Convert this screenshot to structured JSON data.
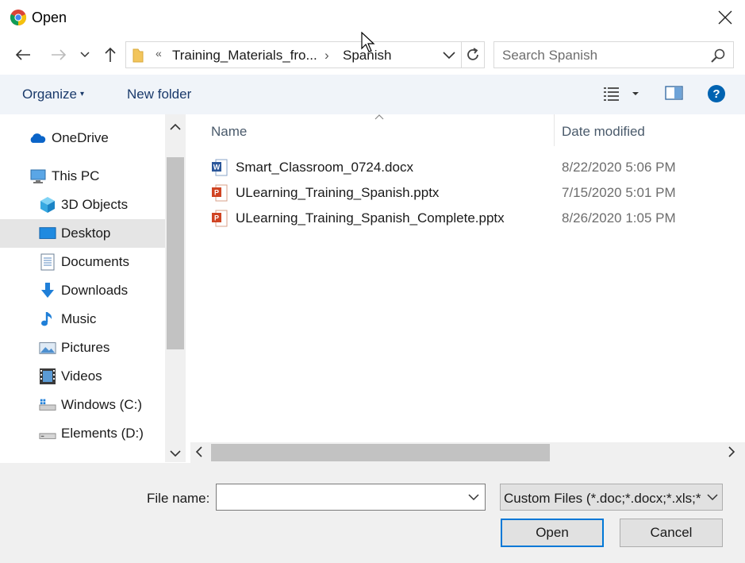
{
  "window": {
    "title": "Open",
    "app_icon": "chrome-icon",
    "close_icon": "close-icon"
  },
  "navigation": {
    "back_icon": "back-arrow-icon",
    "forward_icon": "forward-arrow-icon",
    "recent_icon": "chevron-down-icon",
    "up_icon": "up-arrow-icon",
    "address": {
      "overflow": "«",
      "crumbs": [
        "Training_Materials_fro...",
        "Spanish"
      ],
      "separator": "›"
    },
    "refresh_icon": "refresh-icon",
    "search": {
      "placeholder": "Search Spanish"
    }
  },
  "commandbar": {
    "organize": "Organize",
    "organize_arrow": "▾",
    "new_folder": "New folder",
    "view_icon": "details-view-icon",
    "preview_icon": "preview-pane-icon",
    "help_icon": "help-icon"
  },
  "sidebar": {
    "items": [
      {
        "label": "OneDrive",
        "icon": "onedrive-icon",
        "selected": false
      },
      {
        "label": "This PC",
        "icon": "this-pc-icon",
        "selected": false
      },
      {
        "label": "3D Objects",
        "icon": "3d-objects-icon",
        "selected": false
      },
      {
        "label": "Desktop",
        "icon": "desktop-icon",
        "selected": true
      },
      {
        "label": "Documents",
        "icon": "documents-icon",
        "selected": false
      },
      {
        "label": "Downloads",
        "icon": "downloads-icon",
        "selected": false
      },
      {
        "label": "Music",
        "icon": "music-icon",
        "selected": false
      },
      {
        "label": "Pictures",
        "icon": "pictures-icon",
        "selected": false
      },
      {
        "label": "Videos",
        "icon": "videos-icon",
        "selected": false
      },
      {
        "label": "Windows (C:)",
        "icon": "drive-c-icon",
        "selected": false
      },
      {
        "label": "Elements (D:)",
        "icon": "drive-d-icon",
        "selected": false
      }
    ]
  },
  "filelist": {
    "columns": [
      "Name",
      "Date modified"
    ],
    "files": [
      {
        "name": "Smart_Classroom_0724.docx",
        "date": "8/22/2020 5:06 PM",
        "type": "word"
      },
      {
        "name": "ULearning_Training_Spanish.pptx",
        "date": "7/15/2020 5:01 PM",
        "type": "powerpoint"
      },
      {
        "name": "ULearning_Training_Spanish_Complete.pptx",
        "date": "8/26/2020 1:05 PM",
        "type": "powerpoint"
      }
    ]
  },
  "footer": {
    "file_name_label": "File name:",
    "file_name_value": "",
    "filter": "Custom Files (*.doc;*.docx;*.xls;*.xlsx;*.ppt;*.pptx)",
    "open": "Open",
    "cancel": "Cancel"
  },
  "colors": {
    "accent": "#0078d7",
    "commandbar_bg": "#f0f4f9",
    "selected_bg": "#e5e5e5"
  }
}
